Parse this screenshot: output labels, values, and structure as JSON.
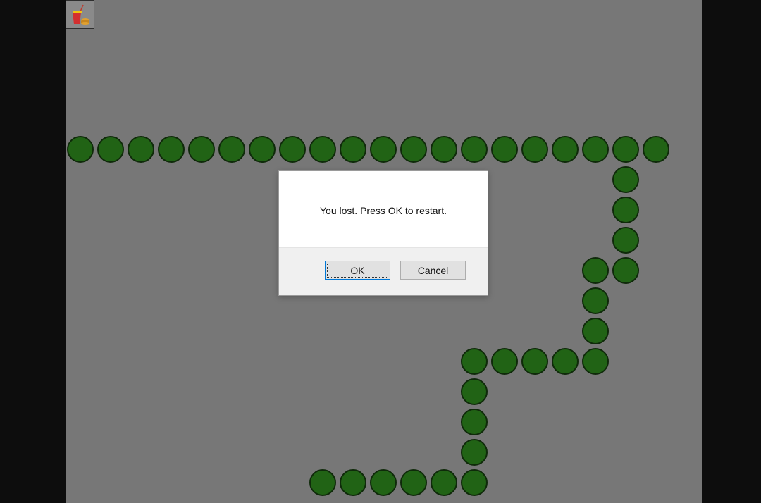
{
  "game": {
    "snake_segments": [
      [
        0,
        4
      ],
      [
        1,
        4
      ],
      [
        2,
        4
      ],
      [
        3,
        4
      ],
      [
        4,
        4
      ],
      [
        5,
        4
      ],
      [
        6,
        4
      ],
      [
        7,
        4
      ],
      [
        8,
        4
      ],
      [
        9,
        4
      ],
      [
        10,
        4
      ],
      [
        11,
        4
      ],
      [
        12,
        4
      ],
      [
        13,
        4
      ],
      [
        14,
        4
      ],
      [
        15,
        4
      ],
      [
        16,
        4
      ],
      [
        17,
        4
      ],
      [
        18,
        4
      ],
      [
        19,
        4
      ],
      [
        18,
        5
      ],
      [
        18,
        6
      ],
      [
        18,
        7
      ],
      [
        18,
        8
      ],
      [
        17,
        8
      ],
      [
        17,
        9
      ],
      [
        17,
        10
      ],
      [
        17,
        11
      ],
      [
        16,
        11
      ],
      [
        15,
        11
      ],
      [
        14,
        11
      ],
      [
        13,
        11
      ],
      [
        13,
        12
      ],
      [
        13,
        13
      ],
      [
        13,
        14
      ],
      [
        13,
        15
      ],
      [
        12,
        15
      ],
      [
        11,
        15
      ],
      [
        10,
        15
      ],
      [
        9,
        15
      ],
      [
        8,
        15
      ]
    ],
    "food_icon": "food-icon",
    "colors": {
      "board": "#777777",
      "snake": "#216315",
      "snake_outline": "#0f2a0a",
      "outside": "#0d0d0d"
    }
  },
  "dialog": {
    "message": "You lost. Press OK to restart.",
    "ok_label": "OK",
    "cancel_label": "Cancel"
  }
}
